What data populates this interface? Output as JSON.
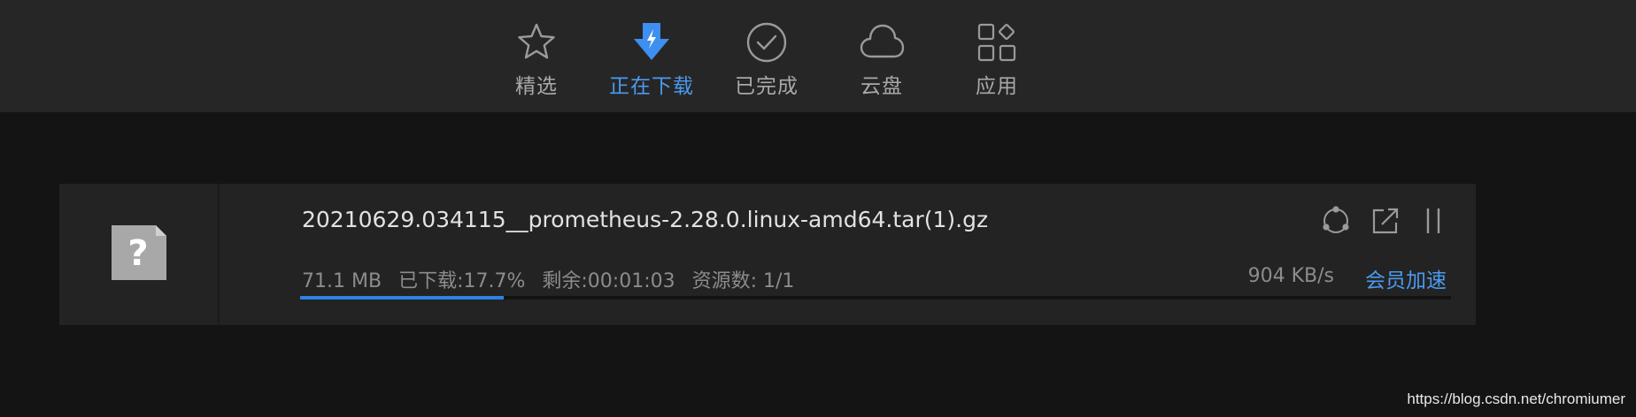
{
  "nav": {
    "tabs": [
      {
        "label": "精选",
        "icon": "star-icon",
        "active": false
      },
      {
        "label": "正在下载",
        "icon": "download-arrow-icon",
        "active": true
      },
      {
        "label": "已完成",
        "icon": "check-circle-icon",
        "active": false
      },
      {
        "label": "云盘",
        "icon": "cloud-icon",
        "active": false
      },
      {
        "label": "应用",
        "icon": "apps-grid-icon",
        "active": false
      }
    ]
  },
  "download": {
    "file_icon": "unknown-file-icon",
    "filename": "20210629.034115__prometheus-2.28.0.linux-amd64.tar(1).gz",
    "size": "71.1 MB",
    "downloaded": "已下载:17.7%",
    "remaining": "剩余:00:01:03",
    "sources": "资源数: 1/1",
    "speed": "904 KB/s",
    "vip_label": "会员加速",
    "progress": 0.177,
    "actions": [
      "share-nodes-icon",
      "open-external-icon",
      "pause-icon"
    ]
  },
  "colors": {
    "accent": "#4a9aef",
    "progress": "#2f82e3",
    "background": "#141414",
    "nav_background": "#262626",
    "card_background": "#232323"
  },
  "watermark": "https://blog.csdn.net/chromiumer"
}
